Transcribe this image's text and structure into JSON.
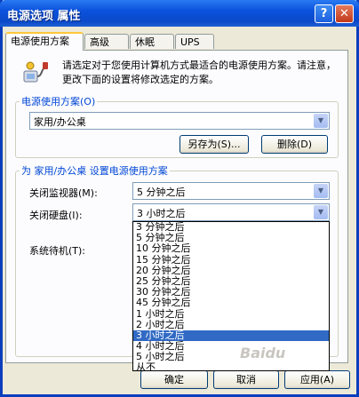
{
  "window": {
    "title": "电源选项 属性",
    "help_glyph": "?",
    "close_glyph": "✕"
  },
  "tabs": [
    {
      "label": "电源使用方案",
      "active": true
    },
    {
      "label": "高级"
    },
    {
      "label": "休眠"
    },
    {
      "label": "UPS"
    }
  ],
  "info": {
    "text": "请选定对于您使用计算机方式最适合的电源使用方案。请注意，更改下面的设置将修改选定的方案。",
    "icon": "power-plug-icon"
  },
  "scheme_group": {
    "legend": "电源使用方案(O)",
    "selected": "家用/办公桌",
    "save_as": "另存为(S)...",
    "delete": "删除(D)"
  },
  "settings_group": {
    "legend": "为 家用/办公桌 设置电源使用方案",
    "monitor_label": "关闭监视器(M):",
    "monitor_value": "5 分钟之后",
    "disk_label": "关闭硬盘(I):",
    "disk_value": "3 小时之后",
    "standby_label": "系统待机(T):"
  },
  "disk_options": [
    "3 分钟之后",
    "5 分钟之后",
    "10 分钟之后",
    "15 分钟之后",
    "20 分钟之后",
    "25 分钟之后",
    "30 分钟之后",
    "45 分钟之后",
    "1 小时之后",
    "2 小时之后",
    "3 小时之后",
    "4 小时之后",
    "5 小时之后",
    "从不"
  ],
  "selected_option_index": 10,
  "footer": {
    "ok": "确定",
    "cancel": "取消",
    "apply": "应用(A)"
  },
  "watermark": "Baidu"
}
